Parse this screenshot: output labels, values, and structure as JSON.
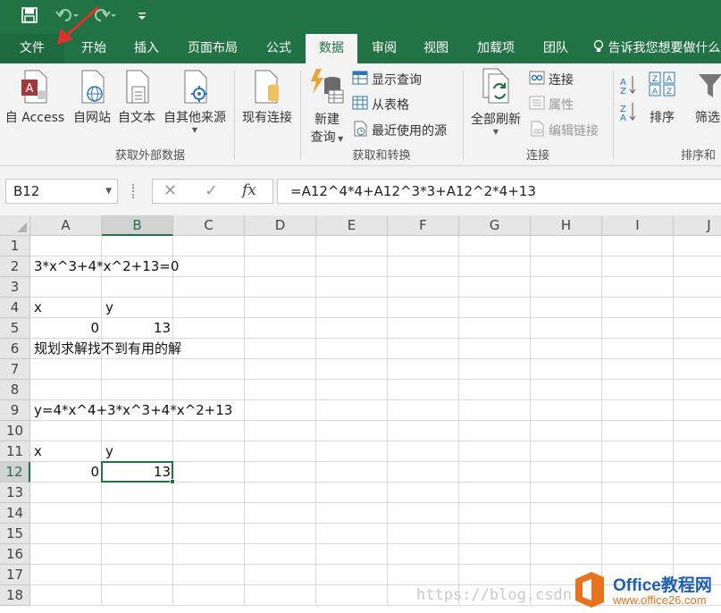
{
  "quick_access": {
    "save_icon": "save-icon",
    "undo_icon": "undo-icon",
    "redo_icon": "redo-icon",
    "customize_icon": "customize-icon"
  },
  "tabs": [
    {
      "label": "文件"
    },
    {
      "label": "开始"
    },
    {
      "label": "插入"
    },
    {
      "label": "页面布局"
    },
    {
      "label": "公式"
    },
    {
      "label": "数据"
    },
    {
      "label": "审阅"
    },
    {
      "label": "视图"
    },
    {
      "label": "加载项"
    },
    {
      "label": "团队"
    }
  ],
  "active_tab": "数据",
  "tell_me": "告诉我您想要做什么",
  "ribbon": {
    "get_external": {
      "from_access": "自 Access",
      "from_web": "自网站",
      "from_text": "自文本",
      "from_other": "自其他来源",
      "existing_conn": "现有连接",
      "label": "获取外部数据"
    },
    "get_transform": {
      "new_query_line1": "新建",
      "new_query_line2": "查询",
      "show_queries": "显示查询",
      "from_table": "从表格",
      "recent_sources": "最近使用的源",
      "label": "获取和转换"
    },
    "connections": {
      "refresh_all": "全部刷新",
      "connections": "连接",
      "properties": "属性",
      "edit_links": "编辑链接",
      "label": "连接"
    },
    "sort_filter": {
      "sort": "排序",
      "filter": "筛选",
      "label": "排序和"
    }
  },
  "formula_bar": {
    "name_box": "B12",
    "cancel_glyph": "✕",
    "enter_glyph": "✓",
    "fx_label": "fx",
    "formula": "=A12^4*4+A12^3*3+A12^2*4+13"
  },
  "grid": {
    "columns": [
      "A",
      "B",
      "C",
      "D",
      "E",
      "F",
      "G",
      "H",
      "I",
      "J"
    ],
    "rows": [
      "1",
      "2",
      "3",
      "4",
      "5",
      "6",
      "7",
      "8",
      "9",
      "10",
      "11",
      "12",
      "13",
      "14",
      "15",
      "16",
      "17",
      "18"
    ],
    "cells": {
      "A2": "3*x^3+4*x^2+13=0",
      "A4": "x",
      "B4": "y",
      "A5": "0",
      "B5": "13",
      "A6": "规划求解找不到有用的解",
      "A9": "y=4*x^4+3*x^3+4*x^2+13",
      "A11": "x",
      "B11": "y",
      "A12": "0",
      "B12": "13"
    },
    "selected_cell": "B12"
  },
  "watermark": "https://blog.csdn.",
  "logo": {
    "brand": "Office教程网",
    "site": "www.office26.com"
  },
  "colors": {
    "excel_green": "#217346",
    "arrow_red": "#e0302c",
    "logo_orange": "#e8731f",
    "logo_blue": "#1f5fb0"
  }
}
